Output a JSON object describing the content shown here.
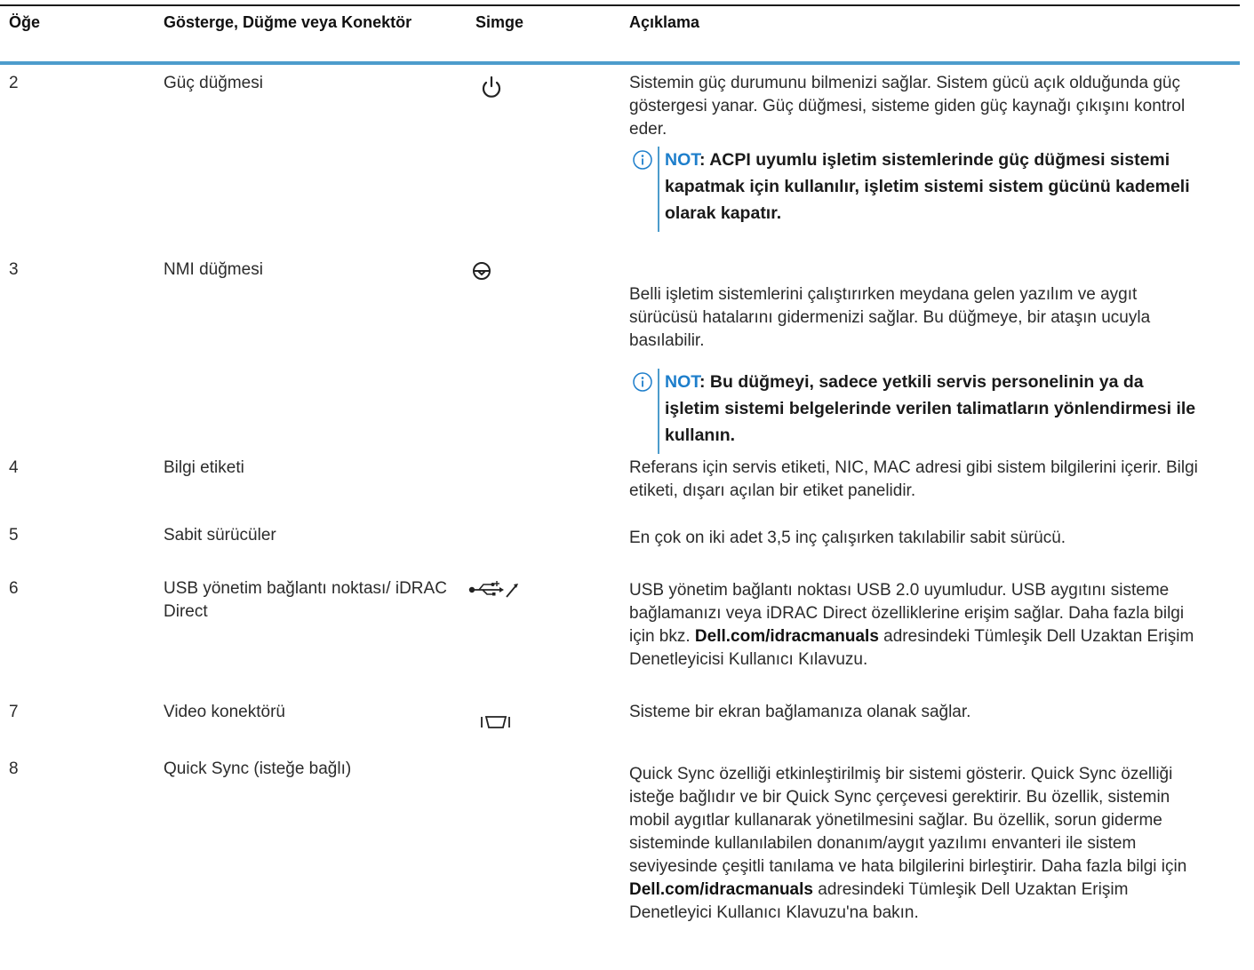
{
  "header": {
    "col1": "Öğe",
    "col2": "Gösterge, Düğme veya Konektör",
    "col3": "Simge",
    "col4": "Açıklama"
  },
  "rows": [
    {
      "item": "2",
      "name": "Güç düğmesi",
      "icon": "power-icon",
      "desc": "Sistemin güç durumunu bilmenizi sağlar. Sistem gücü açık olduğunda güç göstergesi yanar. Güç düğmesi, sisteme giden güç kaynağı çıkışını kontrol eder.",
      "note_label": "NOT",
      "note_text": ": ACPI uyumlu işletim sistemlerinde güç düğmesi sistemi kapatmak için kullanılır, işletim sistemi sistem gücünü kademeli olarak kapatır."
    },
    {
      "item": "3",
      "name": "NMI düğmesi",
      "icon": "nmi-icon",
      "desc": "Belli işletim sistemlerini çalıştırırken meydana gelen yazılım ve aygıt sürücüsü hatalarını gidermenizi sağlar. Bu düğmeye, bir ataşın ucuyla basılabilir.",
      "note_label": "NOT",
      "note_text": ": Bu düğmeyi, sadece yetkili servis personelinin ya da işletim sistemi belgelerinde verilen talimatların yönlendirmesi ile kullanın."
    },
    {
      "item": "4",
      "name": "Bilgi etiketi",
      "desc": "Referans için servis etiketi, NIC, MAC adresi gibi sistem bilgilerini içerir. Bilgi etiketi, dışarı açılan bir etiket panelidir."
    },
    {
      "item": "5",
      "name": "Sabit sürücüler",
      "desc": "En çok on iki adet 3,5 inç çalışırken takılabilir sabit sürücü."
    },
    {
      "item": "6",
      "name": "USB yönetim bağlantı noktası/ iDRAC Direct",
      "icon": "usb-wrench-icon",
      "desc_a": "USB yönetim bağlantı noktası USB 2.0 uyumludur. USB aygıtını sisteme bağlamanızı veya iDRAC Direct özelliklerine erişim sağlar. Daha fazla bilgi için bkz. ",
      "desc_link": "Dell.com/idracmanuals",
      "desc_b": " adresindeki Tümleşik Dell Uzaktan Erişim Denetleyicisi Kullanıcı Kılavuzu."
    },
    {
      "item": "7",
      "name": "Video konektörü",
      "icon": "video-connector-icon",
      "desc": "Sisteme bir ekran bağlamanıza olanak sağlar."
    },
    {
      "item": "8",
      "name": "Quick Sync (isteğe bağlı)",
      "desc_a": "Quick Sync özelliği etkinleştirilmiş bir sistemi gösterir. Quick Sync özelliği isteğe bağlıdır ve bir Quick Sync çerçevesi gerektirir. Bu özellik, sistemin mobil aygıtlar kullanarak yönetilmesini sağlar. Bu özellik, sorun giderme sisteminde kullanılabilen donanım/aygıt yazılımı envanteri ile sistem seviyesinde çeşitli tanılama ve hata bilgilerini birleştirir. Daha fazla bilgi için ",
      "desc_link": "Dell.com/idracmanuals",
      "desc_b": " adresindeki Tümleşik Dell Uzaktan Erişim Denetleyici Kullanıcı Klavuzu'na bakın."
    }
  ]
}
